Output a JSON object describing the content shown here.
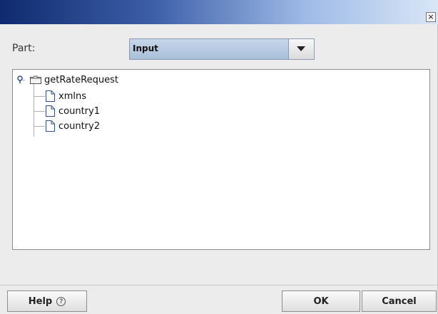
{
  "window": {
    "close_glyph": "×"
  },
  "form": {
    "part_label": "Part:",
    "part_select_value": "Input"
  },
  "tree": {
    "root": "getRateRequest",
    "children": [
      "xmlns",
      "country1",
      "country2"
    ]
  },
  "buttons": {
    "help": "Help",
    "help_icon_glyph": "?",
    "ok": "OK",
    "cancel": "Cancel"
  },
  "colors": {
    "titlebar_start": "#0f2a6e",
    "titlebar_end": "#d9e6f6",
    "combo_bg": "#b9cbe2"
  },
  "icons": {
    "expander": "tree-node-expanded-icon",
    "root": "folder-icon",
    "child": "document-icon"
  }
}
